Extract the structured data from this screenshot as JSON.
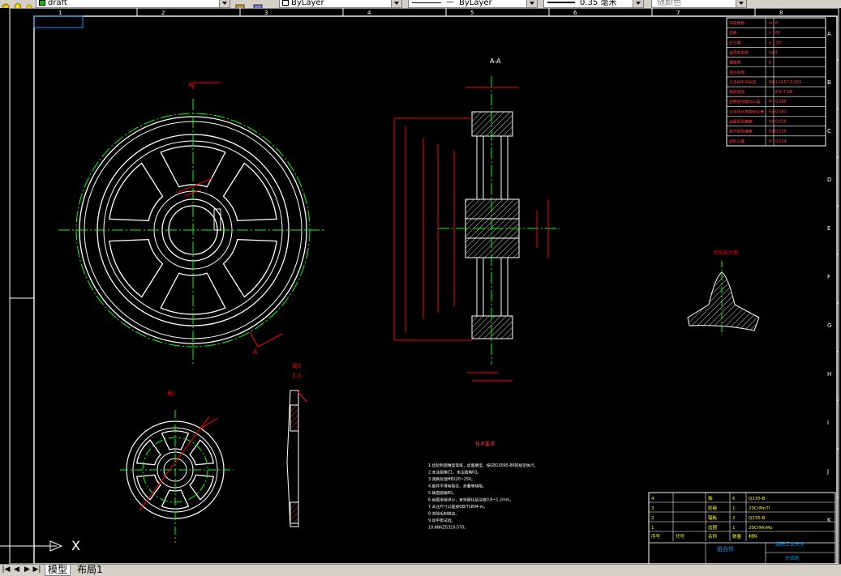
{
  "toolbar": {
    "layer_name": "draft",
    "color_value": "ByLayer",
    "linetype_value": "ByLayer",
    "lineweight_value": "0.35 毫米",
    "plotstyle_value": "随颜色"
  },
  "tabs": {
    "model": "模型",
    "layout1": "布局1"
  },
  "ucs": {
    "x_label": "X"
  },
  "border": {
    "top_numbers": [
      "1",
      "2",
      "3",
      "4",
      "5",
      "6",
      "7",
      "8"
    ],
    "right_letters": [
      "A",
      "B",
      "C",
      "D",
      "E",
      "F",
      "G",
      "H",
      "I",
      "J",
      "K"
    ]
  },
  "drawing": {
    "section_label": "A-A",
    "section_mark": "A",
    "detail_label_1": "局I",
    "detail_label_2": "局2",
    "scale_label": "1:3",
    "tooth_profile_label": "齿形放大图",
    "notes_title": "技术要求",
    "notes": [
      "1.齿轮制造精度等级，齿面硬度，按GB10095-88的规定执行。",
      "2.未注倒角C1，未注圆角R3。",
      "3.调质处理HB220~250。",
      "4.锻件不得有裂纹、折叠等缺陷。",
      "5.铸造圆角R5。",
      "6.齿面渗碳淬火，有效硬化层深度0.8~1.2mm。",
      "7.未注尺寸公差按GB/T1804-m。",
      "8.去除毛刺锐边。",
      "9.动平衡试验。",
      "10.材料ZG310-570。"
    ]
  },
  "param_table": {
    "rows": [
      [
        "法向模数",
        "m",
        "8"
      ],
      [
        "齿数",
        "z",
        "81"
      ],
      [
        "压力角",
        "α",
        "20°"
      ],
      [
        "齿顶高系数",
        "ha*",
        "1"
      ],
      [
        "螺旋角",
        "β",
        ""
      ],
      [
        "变位系数",
        "",
        ""
      ],
      [
        "公法线平均长度",
        "Wk",
        "114.57-0.055"
      ],
      [
        "精度等级",
        "",
        "8-8-7 GB"
      ],
      [
        "齿圈径向跳动公差",
        "Fr",
        "0.090"
      ],
      [
        "公法线长度变动公差",
        "Fw",
        "0.063"
      ],
      [
        "齿距极限偏差",
        "fpt",
        "0.018"
      ],
      [
        "基节极限偏差",
        "fpb",
        "0.016"
      ],
      [
        "齿形公差",
        "ff",
        "0.014"
      ]
    ]
  },
  "bom": {
    "rows": [
      [
        "4",
        "",
        "轴",
        "6",
        "Q235-B"
      ],
      [
        "3",
        "",
        "轮毂",
        "1",
        "20CrMnTi"
      ],
      [
        "2",
        "",
        "辐板",
        "2",
        "Q235-B"
      ],
      [
        "1",
        "",
        "齿圈",
        "1",
        "20CrMnMo"
      ]
    ],
    "title_cells": {
      "assembly": "组合件",
      "school": "湖南工业大学",
      "drawing_name": "大齿轮",
      "header_seq": "序号",
      "header_code": "代号",
      "header_name": "名称",
      "header_qty": "数量",
      "header_mat": "材料"
    }
  },
  "colors": {
    "background": "#000000",
    "white_lines": "#ffffff",
    "center_lines": "#00ff00",
    "dimensions": "#ff0000",
    "table_text": "#ffff00",
    "title_blue": "#00a0ff",
    "hatch": "#ffffff"
  }
}
